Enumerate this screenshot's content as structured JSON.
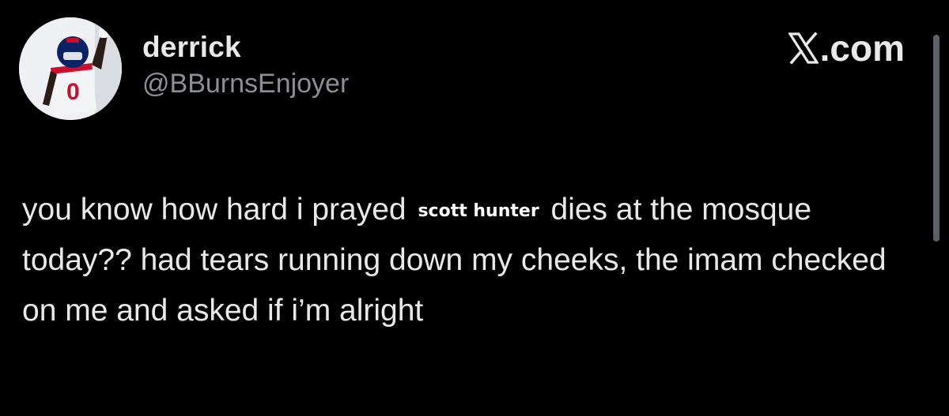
{
  "user": {
    "display_name": "derrick",
    "handle": "@BBurnsEnjoyer"
  },
  "brand": {
    "label": ".com",
    "icon": "x-logo-icon"
  },
  "tweet": {
    "text_part1": "you know how hard i prayed ",
    "redaction_label": "scott hunter",
    "text_part2": " dies at the mosque today??  had tears running down my cheeks, the imam checked on me and asked if i’m alright"
  },
  "colors": {
    "background": "#000000",
    "primary_text": "#e7e9ea",
    "secondary_text": "#8b9096",
    "jersey_red": "#c8102e",
    "jersey_blue": "#0b2265"
  }
}
